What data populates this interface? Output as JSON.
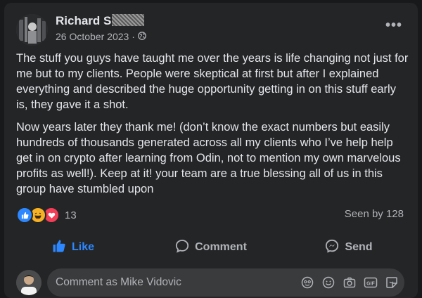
{
  "post": {
    "author_name": "Richard S",
    "date": "26 October 2023",
    "audience_icon": "globe-icon",
    "more_label": "•••",
    "paragraphs": [
      "The stuff you guys have taught me over the years is life changing not just for me but to my clients. People were skeptical at first but after I explained everything and described the huge opportunity getting in on this stuff early is, they gave it a shot.",
      "Now years later they thank me! (don’t know the exact numbers but easily hundreds of thousands generated across all my clients who I’ve help help get in on crypto after learning from Odin, not to mention my own marvelous profits as well!). Keep at it! your team are a true blessing all of us in this group have stumbled upon"
    ],
    "reactions": {
      "icons": [
        "like-reaction-icon",
        "haha-reaction-icon",
        "love-reaction-icon"
      ],
      "count": "13"
    },
    "seen_by": "Seen by 128"
  },
  "actions": {
    "like": "Like",
    "comment": "Comment",
    "send": "Send"
  },
  "comment_box": {
    "placeholder": "Comment as Mike Vidovic",
    "icons": [
      "avatar-sticker-icon",
      "emoji-icon",
      "camera-icon",
      "gif-icon",
      "sticker-icon"
    ]
  },
  "colors": {
    "background": "#18191a",
    "card": "#242526",
    "text": "#e4e6eb",
    "muted": "#b0b3b8",
    "like_blue": "#2d88ff",
    "love_red": "#f33e58",
    "haha_yellow": "#f7b125"
  }
}
